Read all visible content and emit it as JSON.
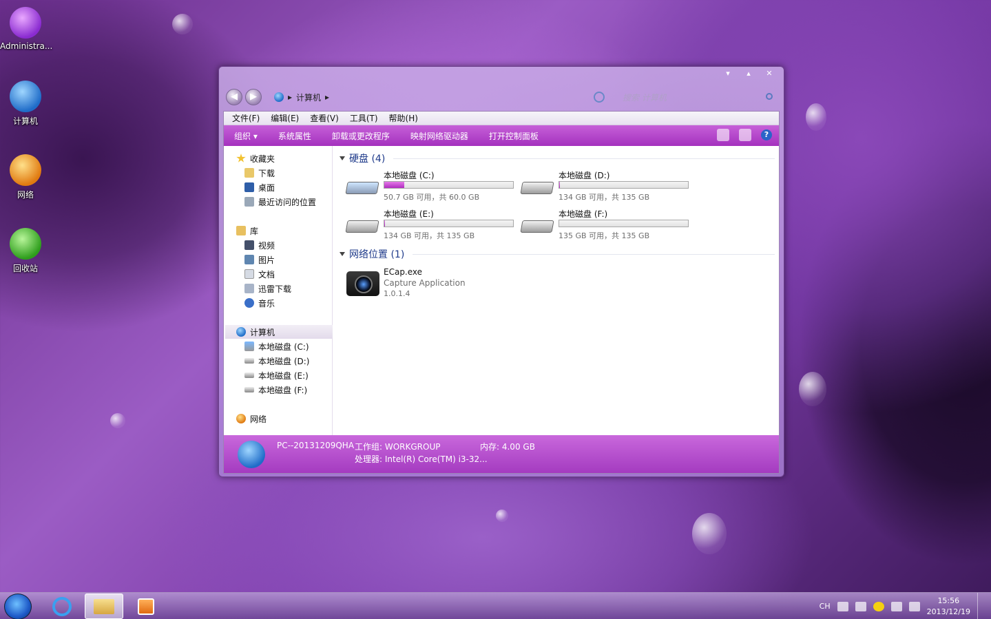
{
  "desktop": {
    "icons": [
      {
        "label": "Administra..."
      },
      {
        "label": "计算机"
      },
      {
        "label": "网络"
      },
      {
        "label": "回收站"
      }
    ]
  },
  "window": {
    "controls": {
      "minimize": "▾",
      "maximize": "▴",
      "close": "✕"
    },
    "address": {
      "back": "◀",
      "forward": "▶",
      "crumb": "计算机",
      "sep": "▸"
    },
    "search": {
      "placeholder": "搜索 计算机"
    },
    "menu": [
      "文件(F)",
      "编辑(E)",
      "查看(V)",
      "工具(T)",
      "帮助(H)"
    ],
    "toolbar": [
      "组织 ▾",
      "系统属性",
      "卸载或更改程序",
      "映射网络驱动器",
      "打开控制面板"
    ],
    "help_label": "?",
    "nav": {
      "favorites": "收藏夹",
      "fav_items": [
        "下载",
        "桌面",
        "最近访问的位置"
      ],
      "libraries": "库",
      "lib_items": [
        "视频",
        "图片",
        "文档",
        "迅雷下载",
        "音乐"
      ],
      "computer": "计算机",
      "computer_items": [
        "本地磁盘 (C:)",
        "本地磁盘 (D:)",
        "本地磁盘 (E:)",
        "本地磁盘 (F:)"
      ],
      "network": "网络"
    },
    "groups": {
      "hdd": "硬盘 (4)",
      "net": "网络位置 (1)"
    },
    "drives": [
      {
        "name": "本地磁盘 (C:)",
        "size": "50.7 GB 可用，共 60.0 GB",
        "used_fraction": 0.155
      },
      {
        "name": "本地磁盘 (D:)",
        "size": "134 GB 可用，共 135 GB",
        "used_fraction": 0.007
      },
      {
        "name": "本地磁盘 (E:)",
        "size": "134 GB 可用，共 135 GB",
        "used_fraction": 0.007
      },
      {
        "name": "本地磁盘 (F:)",
        "size": "135 GB 可用，共 135 GB",
        "used_fraction": 0.0
      }
    ],
    "app": {
      "name": "ECap.exe",
      "desc": "Capture Application",
      "version": "1.0.1.4"
    },
    "details": {
      "pc": "PC--20131209QHA",
      "workgroup": "工作组: WORKGROUP",
      "memory": "内存: 4.00 GB",
      "cpu": "处理器: Intel(R) Core(TM) i3-32..."
    }
  },
  "taskbar": {
    "lang": "CH",
    "time": "15:56",
    "date": "2013/12/19"
  },
  "colors": {
    "accent": "#b43fc8",
    "link": "#1e3a8a"
  }
}
